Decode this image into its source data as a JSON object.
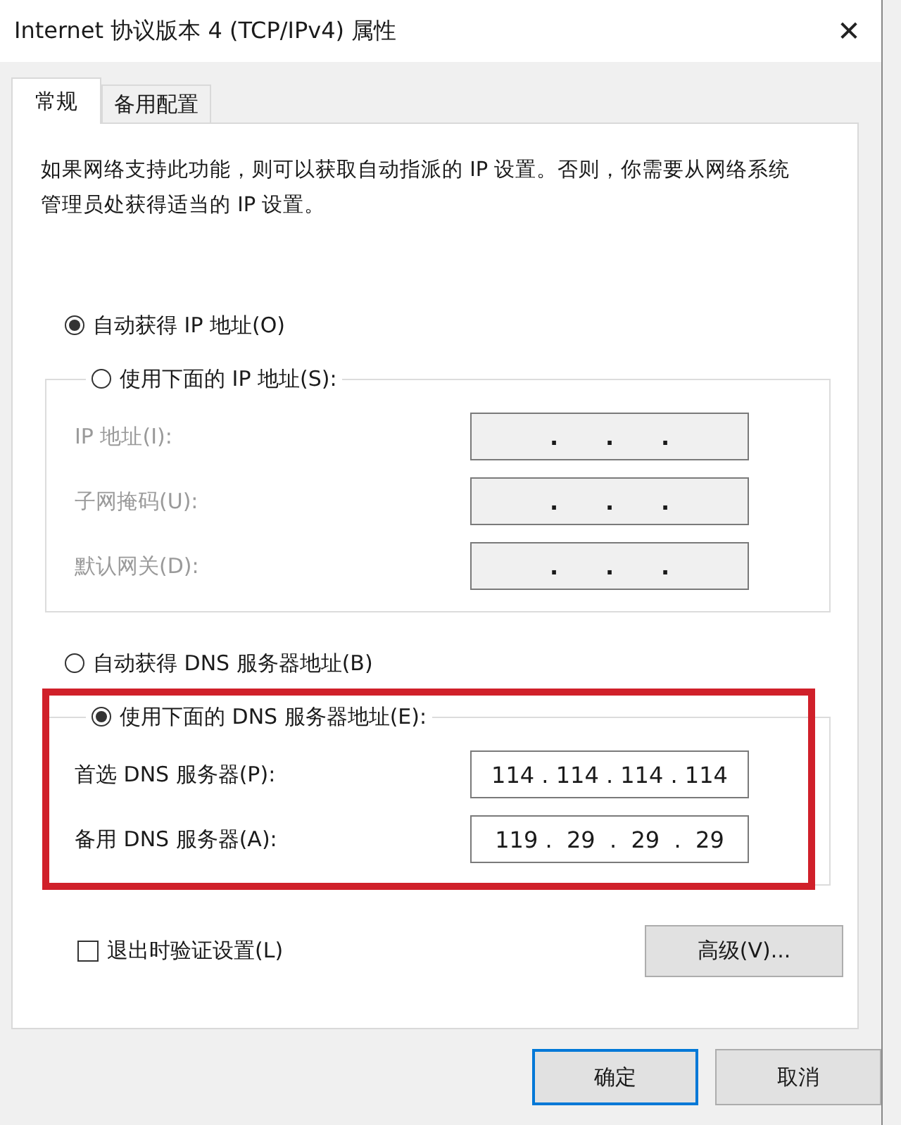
{
  "window": {
    "title": "Internet 协议版本 4 (TCP/IPv4) 属性",
    "close_label": "✕"
  },
  "tabs": [
    {
      "label": "常规",
      "selected": true
    },
    {
      "label": "备用配置",
      "selected": false
    }
  ],
  "description": "如果网络支持此功能，则可以获取自动指派的 IP 设置。否则，你需要从网络系统管理员处获得适当的 IP 设置。",
  "ip_group": {
    "options": [
      {
        "label": "自动获得 IP 地址(O)",
        "selected": true
      },
      {
        "label": "使用下面的 IP 地址(S):",
        "selected": false
      }
    ],
    "fields": [
      {
        "label": "IP 地址(I):",
        "disabled": true,
        "value": ".      .      ."
      },
      {
        "label": "子网掩码(U):",
        "disabled": true,
        "value": ".      .      ."
      },
      {
        "label": "默认网关(D):",
        "disabled": true,
        "value": ".      .      ."
      }
    ]
  },
  "dns_group": {
    "options": [
      {
        "label": "自动获得 DNS 服务器地址(B)",
        "selected": false
      },
      {
        "label": "使用下面的 DNS 服务器地址(E):",
        "selected": true
      }
    ],
    "fields": [
      {
        "label": "首选 DNS 服务器(P):",
        "disabled": false,
        "value": "114 . 114 . 114 . 114"
      },
      {
        "label": "备用 DNS 服务器(A):",
        "disabled": false,
        "value": "119 .  29  .  29  .  29"
      }
    ],
    "highlighted": true
  },
  "validate": {
    "label": "退出时验证设置(L)",
    "checked": false
  },
  "advanced_button": "高级(V)...",
  "buttons": [
    {
      "label": "确定",
      "default": true
    },
    {
      "label": "取消",
      "default": false
    }
  ]
}
